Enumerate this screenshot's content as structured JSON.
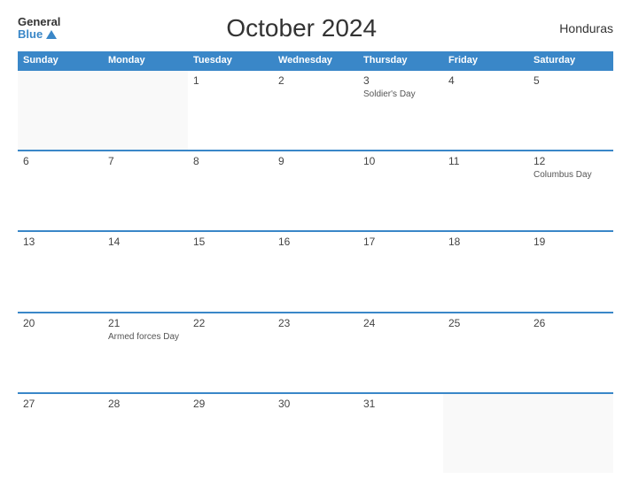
{
  "header": {
    "logo_general": "General",
    "logo_blue": "Blue",
    "title": "October 2024",
    "country": "Honduras"
  },
  "calendar": {
    "day_headers": [
      "Sunday",
      "Monday",
      "Tuesday",
      "Wednesday",
      "Thursday",
      "Friday",
      "Saturday"
    ],
    "weeks": [
      [
        {
          "number": "",
          "event": ""
        },
        {
          "number": "",
          "event": ""
        },
        {
          "number": "1",
          "event": ""
        },
        {
          "number": "2",
          "event": ""
        },
        {
          "number": "3",
          "event": "Soldier's Day"
        },
        {
          "number": "4",
          "event": ""
        },
        {
          "number": "5",
          "event": ""
        }
      ],
      [
        {
          "number": "6",
          "event": ""
        },
        {
          "number": "7",
          "event": ""
        },
        {
          "number": "8",
          "event": ""
        },
        {
          "number": "9",
          "event": ""
        },
        {
          "number": "10",
          "event": ""
        },
        {
          "number": "11",
          "event": ""
        },
        {
          "number": "12",
          "event": "Columbus Day"
        }
      ],
      [
        {
          "number": "13",
          "event": ""
        },
        {
          "number": "14",
          "event": ""
        },
        {
          "number": "15",
          "event": ""
        },
        {
          "number": "16",
          "event": ""
        },
        {
          "number": "17",
          "event": ""
        },
        {
          "number": "18",
          "event": ""
        },
        {
          "number": "19",
          "event": ""
        }
      ],
      [
        {
          "number": "20",
          "event": ""
        },
        {
          "number": "21",
          "event": "Armed forces Day"
        },
        {
          "number": "22",
          "event": ""
        },
        {
          "number": "23",
          "event": ""
        },
        {
          "number": "24",
          "event": ""
        },
        {
          "number": "25",
          "event": ""
        },
        {
          "number": "26",
          "event": ""
        }
      ],
      [
        {
          "number": "27",
          "event": ""
        },
        {
          "number": "28",
          "event": ""
        },
        {
          "number": "29",
          "event": ""
        },
        {
          "number": "30",
          "event": ""
        },
        {
          "number": "31",
          "event": ""
        },
        {
          "number": "",
          "event": ""
        },
        {
          "number": "",
          "event": ""
        }
      ]
    ]
  }
}
